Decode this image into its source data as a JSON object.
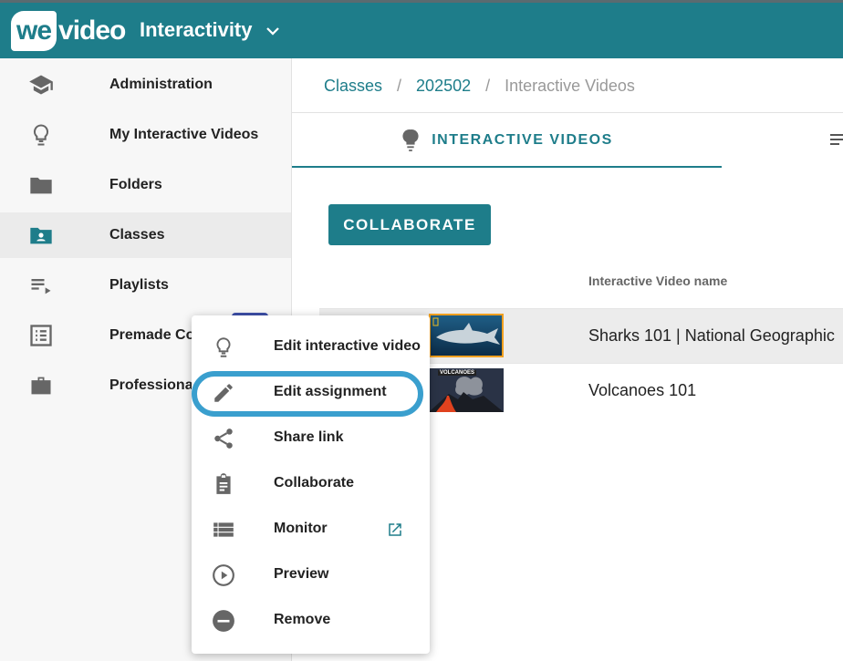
{
  "app": {
    "logo_part1": "we",
    "logo_part2": "video",
    "title": "Interactivity"
  },
  "sidebar": {
    "items": [
      {
        "label": "Administration",
        "icon": "graduation-cap-icon"
      },
      {
        "label": "My Interactive Videos",
        "icon": "lightbulb-icon"
      },
      {
        "label": "Folders",
        "icon": "folder-icon"
      },
      {
        "label": "Classes",
        "icon": "class-folder-icon",
        "active": true
      },
      {
        "label": "Playlists",
        "icon": "playlist-icon"
      },
      {
        "label": "Premade Co",
        "icon": "list-alt-icon"
      },
      {
        "label": "Professional",
        "icon": "briefcase-icon"
      }
    ]
  },
  "breadcrumb": {
    "items": [
      "Classes",
      "202502"
    ],
    "separator": "/",
    "current": "Interactive Videos"
  },
  "tabs": {
    "active_label": "INTERACTIVE VIDEOS"
  },
  "toolbar": {
    "collaborate_label": "COLLABORATE"
  },
  "table": {
    "column_name": "Interactive Video name",
    "rows": [
      {
        "title": "Sharks 101 | National Geographic"
      },
      {
        "title": "Volcanoes 101",
        "thumb_text": "VOLCANOES"
      }
    ]
  },
  "context_menu": {
    "items": [
      {
        "label": "Edit interactive video",
        "icon": "lightbulb-icon"
      },
      {
        "label": "Edit assignment",
        "icon": "pencil-icon"
      },
      {
        "label": "Share link",
        "icon": "share-icon"
      },
      {
        "label": "Collaborate",
        "icon": "clipboard-icon"
      },
      {
        "label": "Monitor",
        "icon": "list-icon"
      },
      {
        "label": "Preview",
        "icon": "play-circle-icon"
      },
      {
        "label": "Remove",
        "icon": "remove-circle-icon"
      }
    ]
  },
  "colors": {
    "brand": "#1e7d8a",
    "highlight": "#3a9fce",
    "icon_gray": "#666666"
  }
}
